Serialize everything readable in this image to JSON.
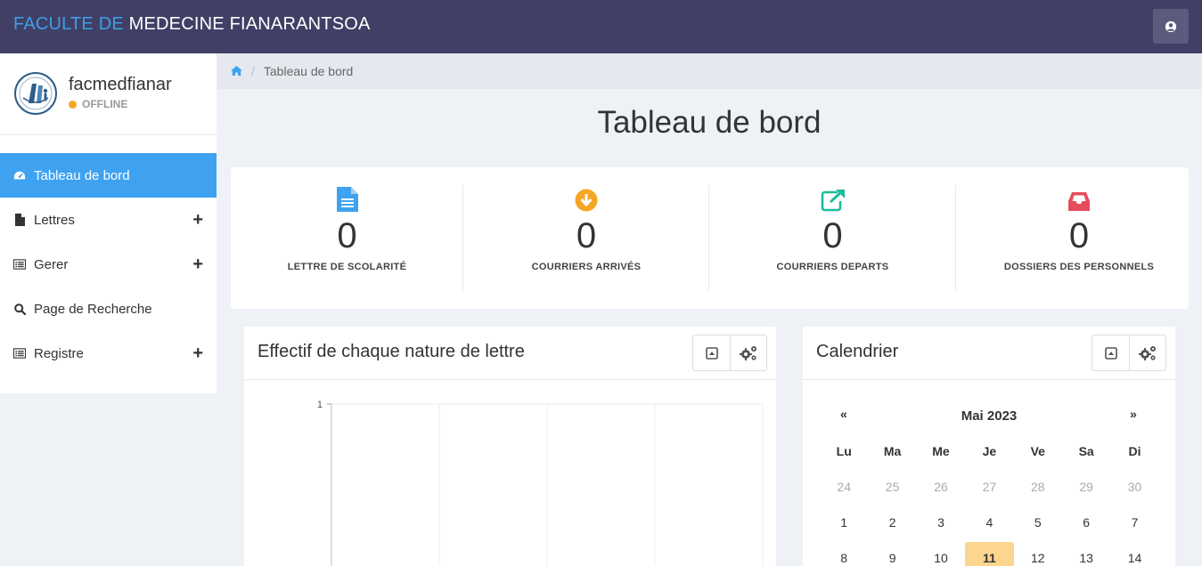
{
  "topbar": {
    "brand_part1": "FACULTE DE",
    "brand_part2": "MEDECINE FIANARANTSOA",
    "brand_color": "#3c9fe8",
    "bg_color": "#423f66",
    "user_icon": "user-circle-icon"
  },
  "sidebar": {
    "username": "facmedfianar",
    "status": "OFFLINE",
    "status_color": "#f5a623",
    "items": [
      {
        "label": "Tableau de bord",
        "icon": "dashboard-icon",
        "active": true,
        "expandable": false
      },
      {
        "label": "Lettres",
        "icon": "file-icon",
        "active": false,
        "expandable": true
      },
      {
        "label": "Gerer",
        "icon": "list-icon",
        "active": false,
        "expandable": true
      },
      {
        "label": "Page de Recherche",
        "icon": "search-icon",
        "active": false,
        "expandable": false
      },
      {
        "label": "Registre",
        "icon": "list-icon",
        "active": false,
        "expandable": true
      }
    ],
    "expand_symbol": "+"
  },
  "breadcrumb": {
    "home_icon": "home-icon",
    "separator": "/",
    "current": "Tableau de bord"
  },
  "page": {
    "title": "Tableau de bord"
  },
  "stats": [
    {
      "value": "0",
      "label": "LETTRE DE SCOLARITÉ",
      "icon": "file-text-icon",
      "color": "#3ea2f0"
    },
    {
      "value": "0",
      "label": "COURRIERS ARRIVÉS",
      "icon": "arrow-down-circle-icon",
      "color": "#f5a623"
    },
    {
      "value": "0",
      "label": "COURRIERS DEPARTS",
      "icon": "external-link-icon",
      "color": "#1bbc9b"
    },
    {
      "value": "0",
      "label": "DOSSIERS DES PERSONNELS",
      "icon": "inbox-icon",
      "color": "#e74c5c"
    }
  ],
  "chart_panel": {
    "title": "Effectif de chaque nature de lettre",
    "tools": [
      "collapse-icon",
      "settings-icon"
    ]
  },
  "chart_data": {
    "type": "bar",
    "categories": [],
    "values": [],
    "title": "",
    "xlabel": "",
    "ylabel": "",
    "ylim": [
      0,
      1
    ],
    "yticks": [
      "1"
    ],
    "grid": true
  },
  "calendar_panel": {
    "title": "Calendrier",
    "tools": [
      "collapse-icon",
      "settings-icon"
    ],
    "prev": "«",
    "next": "»",
    "month": "Mai 2023",
    "weekdays": [
      "Lu",
      "Ma",
      "Me",
      "Je",
      "Ve",
      "Sa",
      "Di"
    ],
    "weeks": [
      [
        {
          "d": "24",
          "m": true
        },
        {
          "d": "25",
          "m": true
        },
        {
          "d": "26",
          "m": true
        },
        {
          "d": "27",
          "m": true
        },
        {
          "d": "28",
          "m": true
        },
        {
          "d": "29",
          "m": true
        },
        {
          "d": "30",
          "m": true
        }
      ],
      [
        {
          "d": "1"
        },
        {
          "d": "2"
        },
        {
          "d": "3"
        },
        {
          "d": "4"
        },
        {
          "d": "5"
        },
        {
          "d": "6"
        },
        {
          "d": "7"
        }
      ],
      [
        {
          "d": "8"
        },
        {
          "d": "9"
        },
        {
          "d": "10"
        },
        {
          "d": "11",
          "today": true
        },
        {
          "d": "12"
        },
        {
          "d": "13"
        },
        {
          "d": "14"
        }
      ]
    ]
  }
}
